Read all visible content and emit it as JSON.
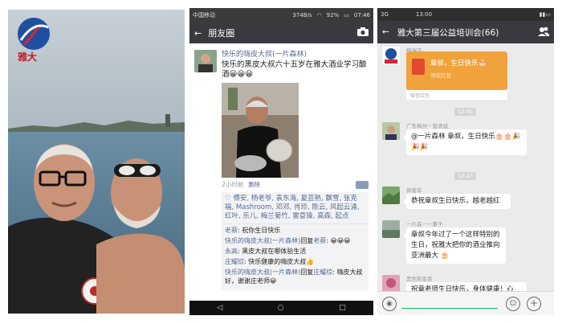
{
  "photo": {
    "logo_text": "雅大"
  },
  "moments": {
    "status_bar": {
      "carrier": "中国移动",
      "speed": "374B/s",
      "battery": "92%",
      "time": "07:46"
    },
    "header": {
      "back_icon": "back-arrow-icon",
      "title": "朋友圈",
      "camera_icon": "camera-icon"
    },
    "post": {
      "author": "快乐的嗨皮大叔(一片森林)",
      "text": "快乐的黑皮大叔六十五岁在雅大酒业学习酿酒😀😀😀",
      "time": "2小时前",
      "delete_label": "删除",
      "likes": "♡ 傅安, 杨老爷, 袁东海, 夏芸熟, 飘雪, 张克福, Mashroom, 邓邓, 肖珍, 陈云, 风起云涌, 红叶, 乐儿, 梅兰菊竹, 雷意锋, 高森, 起点",
      "comments": [
        {
          "name": "老蔡",
          "text": ": 祝你生日快乐"
        },
        {
          "name": "快乐的嗨皮大叔(一片森林)",
          "reply": "回复",
          "target": "老蔡",
          "text": ": 😀😀😀"
        },
        {
          "name": "永高",
          "text": ": 黑皮大叔在哪体验生活"
        },
        {
          "name": "庄耀综",
          "text": ": 快乐健康的嗨皮大叔👍"
        },
        {
          "name": "快乐的嗨皮大叔(一片森林)",
          "reply": "回复",
          "target": "庄耀综",
          "text": ": 嗨皮大叔好，谢谢庄老师😀"
        }
      ]
    },
    "nav": {
      "back": "◁",
      "home": "○",
      "recent": "□"
    }
  },
  "chat": {
    "status_bar": {
      "left": "3G",
      "time": "13:00"
    },
    "header": {
      "back_icon": "back-arrow-icon",
      "title": "雅大第三届公益培训会(66)",
      "group_icon": "group-members-icon"
    },
    "red_packet": {
      "sender": "杨瑞玉",
      "title": "章叔，生日快乐🎂",
      "sub": "领取红包",
      "footer": "微信红包"
    },
    "timestamps": [
      "12:45",
      "12:47"
    ],
    "messages": [
      {
        "sender": "广东梅州－曾清斌",
        "text": "@一片森林 章叔，生日快乐🎂🎂🎉🎉🎉"
      },
      {
        "sender": "郭香军",
        "text": "恭祝章叔生日快乐，越老越红"
      },
      {
        "sender": "一片森－一董子",
        "text": "章叔今年过了一个这样特别的生日，祝雅大把你的酒业推向亚洲最大 🎂"
      },
      {
        "sender": "黑色和金香",
        "text": "祝章老师生日快乐，身体健康！心"
      }
    ],
    "input": {
      "voice_icon": "voice-icon",
      "emoji_icon": "emoji-icon",
      "plus_icon": "plus-icon"
    }
  }
}
